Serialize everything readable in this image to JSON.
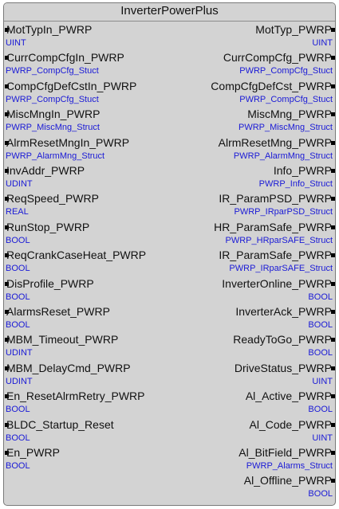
{
  "block": {
    "title": "InverterPowerPlus",
    "inputs": [
      {
        "name": "MotTypIn_PWRP",
        "type": "UINT"
      },
      {
        "name": "CurrCompCfgIn_PWRP",
        "type": "PWRP_CompCfg_Stuct"
      },
      {
        "name": "CompCfgDefCstIn_PWRP",
        "type": "PWRP_CompCfg_Stuct"
      },
      {
        "name": "MiscMngIn_PWRP",
        "type": "PWRP_MiscMng_Struct"
      },
      {
        "name": "AlrmResetMngIn_PWRP",
        "type": "PWRP_AlarmMng_Struct"
      },
      {
        "name": "InvAddr_PWRP",
        "type": "UDINT"
      },
      {
        "name": "ReqSpeed_PWRP",
        "type": "REAL"
      },
      {
        "name": "RunStop_PWRP",
        "type": "BOOL"
      },
      {
        "name": "ReqCrankCaseHeat_PWRP",
        "type": "BOOL"
      },
      {
        "name": "DisProfile_PWRP",
        "type": "BOOL"
      },
      {
        "name": "AlarmsReset_PWRP",
        "type": "BOOL"
      },
      {
        "name": "MBM_Timeout_PWRP",
        "type": "UDINT"
      },
      {
        "name": "MBM_DelayCmd_PWRP",
        "type": "UDINT"
      },
      {
        "name": "En_ResetAlrmRetry_PWRP",
        "type": "BOOL"
      },
      {
        "name": "BLDC_Startup_Reset",
        "type": "BOOL"
      },
      {
        "name": "En_PWRP",
        "type": "BOOL"
      }
    ],
    "outputs": [
      {
        "name": "MotTyp_PWRP",
        "type": "UINT"
      },
      {
        "name": "CurrCompCfg_PWRP",
        "type": "PWRP_CompCfg_Stuct"
      },
      {
        "name": "CompCfgDefCst_PWRP",
        "type": "PWRP_CompCfg_Stuct"
      },
      {
        "name": "MiscMng_PWRP",
        "type": "PWRP_MiscMng_Struct"
      },
      {
        "name": "AlrmResetMng_PWRP",
        "type": "PWRP_AlarmMng_Struct"
      },
      {
        "name": "Info_PWRP",
        "type": "PWRP_Info_Struct"
      },
      {
        "name": "IR_ParamPSD_PWRP",
        "type": "PWRP_IRparPSD_Struct"
      },
      {
        "name": "HR_ParamSafe_PWRP",
        "type": "PWRP_HRparSAFE_Struct"
      },
      {
        "name": "IR_ParamSafe_PWRP",
        "type": "PWRP_IRparSAFE_Struct"
      },
      {
        "name": "InverterOnline_PWRP",
        "type": "BOOL"
      },
      {
        "name": "InverterAck_PWRP",
        "type": "BOOL"
      },
      {
        "name": "ReadyToGo_PWRP",
        "type": "BOOL"
      },
      {
        "name": "DriveStatus_PWRP",
        "type": "UINT"
      },
      {
        "name": "Al_Active_PWRP",
        "type": "BOOL"
      },
      {
        "name": "Al_Code_PWRP",
        "type": "UINT"
      },
      {
        "name": "Al_BitField_PWRP",
        "type": "PWRP_Alarms_Struct"
      },
      {
        "name": "Al_Offline_PWRP",
        "type": "BOOL"
      }
    ]
  }
}
